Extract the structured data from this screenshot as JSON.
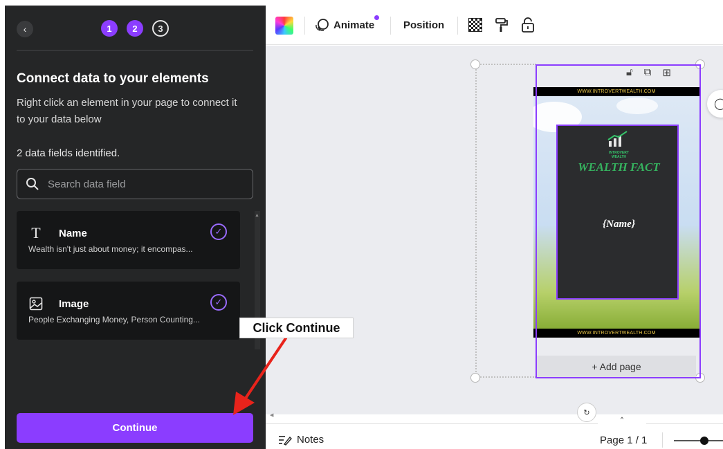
{
  "panel": {
    "back_icon": "chevron-left-icon",
    "steps": [
      "1",
      "2",
      "3"
    ],
    "current_step": 2,
    "title": "Connect data to your elements",
    "description": "Right click an element in your page to connect it to your data below",
    "fields_count": "2 data fields identified.",
    "search": {
      "placeholder": "Search data field",
      "value": ""
    },
    "fields": [
      {
        "icon": "text-icon",
        "name": "Name",
        "value": "Wealth isn't just about money; it encompas...",
        "connected": true
      },
      {
        "icon": "image-icon",
        "name": "Image",
        "value": "People Exchanging Money, Person Counting...",
        "connected": true
      }
    ],
    "continue_label": "Continue",
    "accent_color": "#8b3dff"
  },
  "toolbar": {
    "animate_label": "Animate",
    "position_label": "Position",
    "icons": [
      "color-swatch-icon",
      "animate-icon",
      "transparency-icon",
      "paint-roller-icon",
      "lock-icon"
    ]
  },
  "canvas": {
    "page_tools": [
      "lock-icon",
      "duplicate-icon",
      "add-page-icon"
    ],
    "page": {
      "top_band": "WWW.INTROVERTWEALTH.COM",
      "bottom_band": "WWW.INTROVERTWEALTH.COM",
      "logo_line1": "INTROVERT",
      "logo_line2": "WEALTH",
      "heading": "WEALTH FACT",
      "placeholder": "{Name}"
    },
    "add_page_label": "+ Add page"
  },
  "bottom_bar": {
    "notes_label": "Notes",
    "page_indicator": "Page 1 / 1",
    "zoom_level": 0.78
  },
  "annotation": {
    "callout_text": "Click Continue",
    "arrow_color": "#e8231b"
  }
}
